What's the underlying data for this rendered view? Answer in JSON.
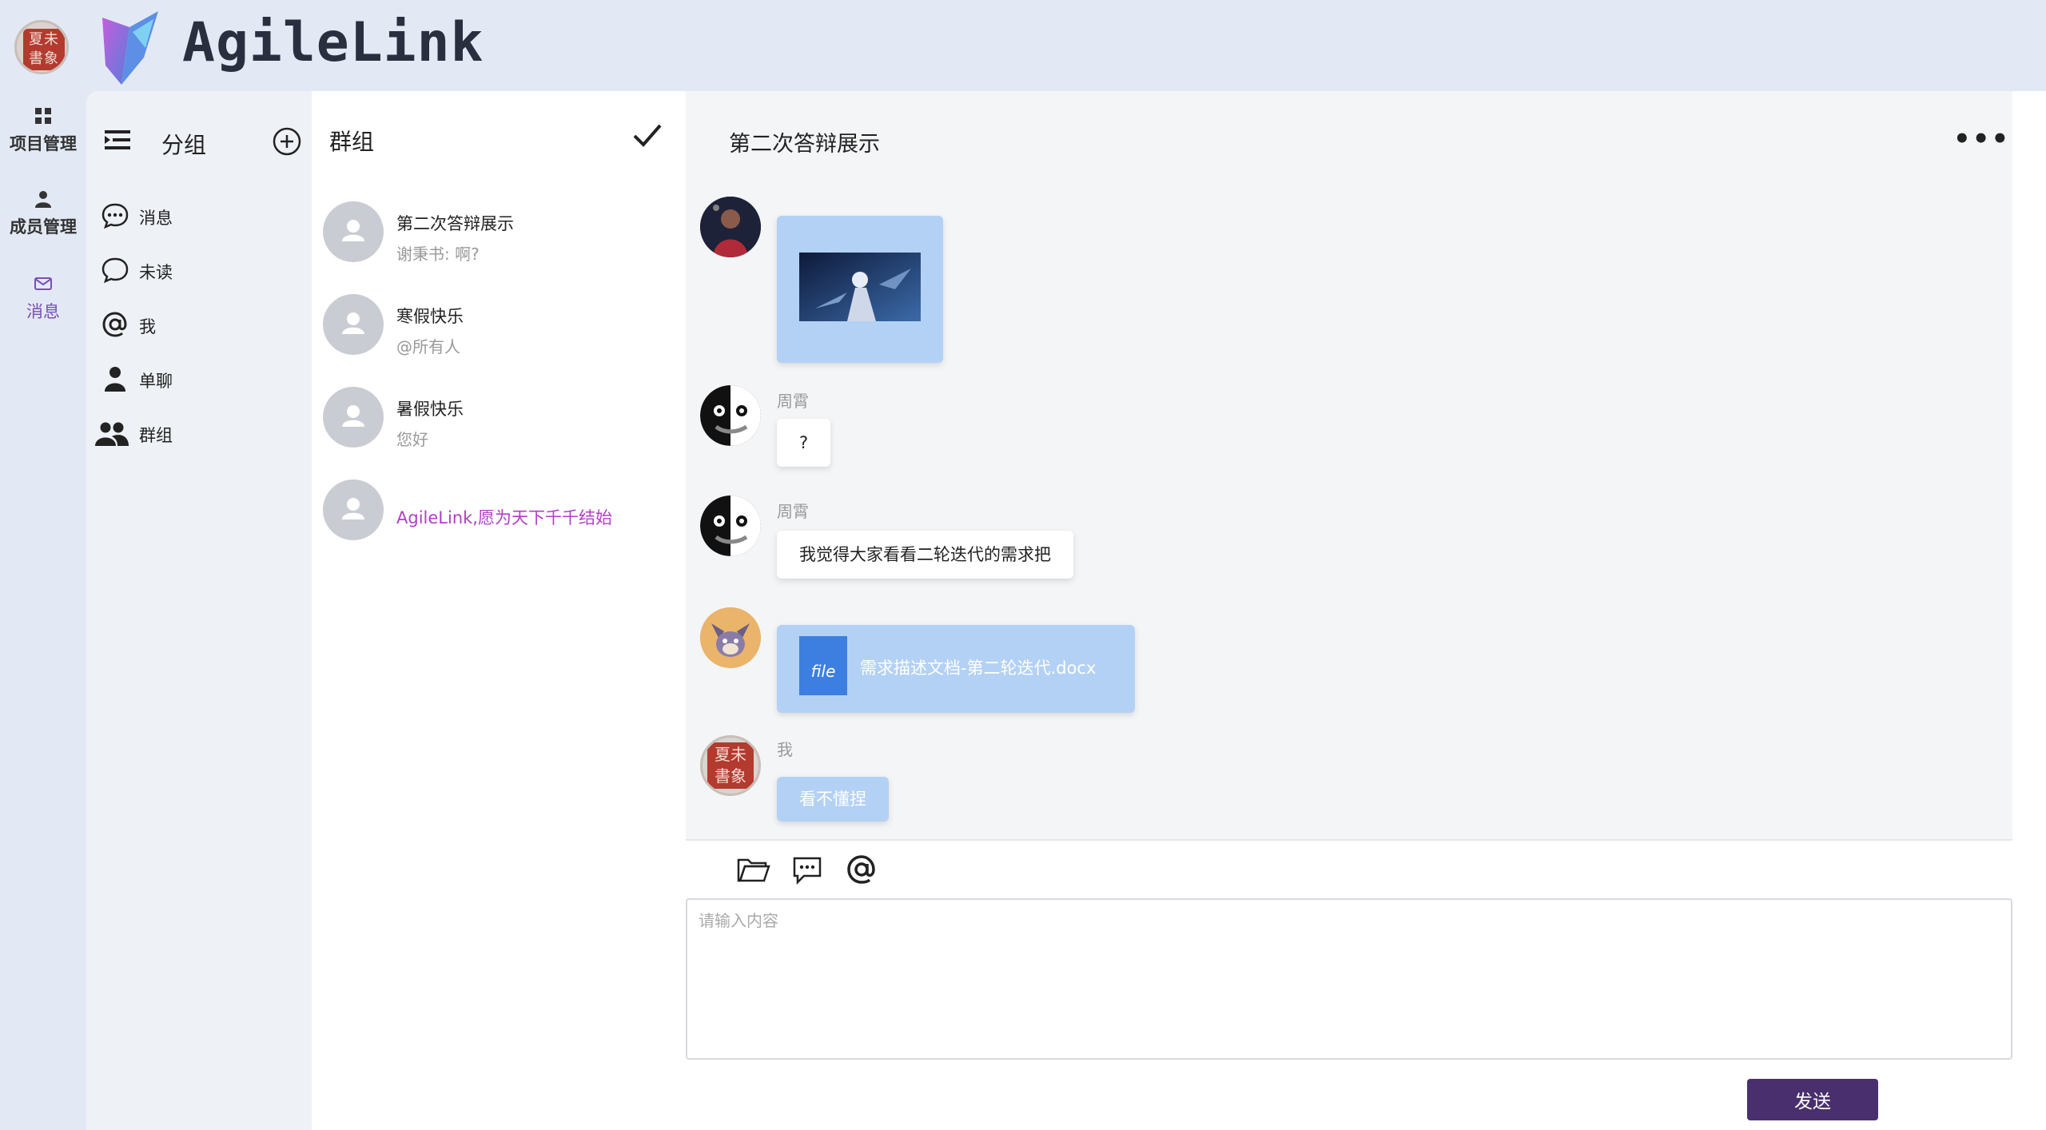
{
  "app": {
    "title": "AgileLink",
    "avatar_seal_text": "夏未\n書象"
  },
  "rail": {
    "items": [
      {
        "label": "项目管理",
        "icon": "grid-icon"
      },
      {
        "label": "成员管理",
        "icon": "person-icon"
      },
      {
        "label": "消息",
        "icon": "mail-icon",
        "active": true
      }
    ]
  },
  "groups": {
    "title": "分组",
    "items": [
      {
        "label": "消息",
        "icon": "chat-dots-icon"
      },
      {
        "label": "未读",
        "icon": "chat-icon"
      },
      {
        "label": "我",
        "icon": "at-icon"
      },
      {
        "label": "单聊",
        "icon": "person-icon"
      },
      {
        "label": "群组",
        "icon": "people-icon"
      }
    ]
  },
  "list": {
    "title": "群组",
    "conversations": [
      {
        "name": "第二次答辩展示",
        "last": "谢秉书: 啊?"
      },
      {
        "name": "寒假快乐",
        "last": "@所有人"
      },
      {
        "name": "暑假快乐",
        "last": "您好"
      }
    ],
    "slogan": "AgileLink,愿为天下千千结始"
  },
  "chat": {
    "title": "第二次答辩展示",
    "messages": [
      {
        "sender": "",
        "type": "image"
      },
      {
        "sender": "周霄",
        "type": "text",
        "text": "?"
      },
      {
        "sender": "周霄",
        "type": "text",
        "text": "我觉得大家看看二轮迭代的需求把"
      },
      {
        "sender": "",
        "type": "file",
        "file_badge": "file",
        "file_name": "需求描述文档-第二轮迭代.docx"
      },
      {
        "sender": "我",
        "type": "text",
        "text": "看不懂捏"
      }
    ],
    "toolbar": [
      "folder-icon",
      "chat-dots-icon",
      "at-icon"
    ],
    "input_placeholder": "请输入内容",
    "send_label": "发送"
  },
  "colors": {
    "accent": "#4a2f6e",
    "bubble_blue": "#b3d1f5",
    "slogan": "#b03fc7",
    "rail_active": "#7a4fb5"
  }
}
